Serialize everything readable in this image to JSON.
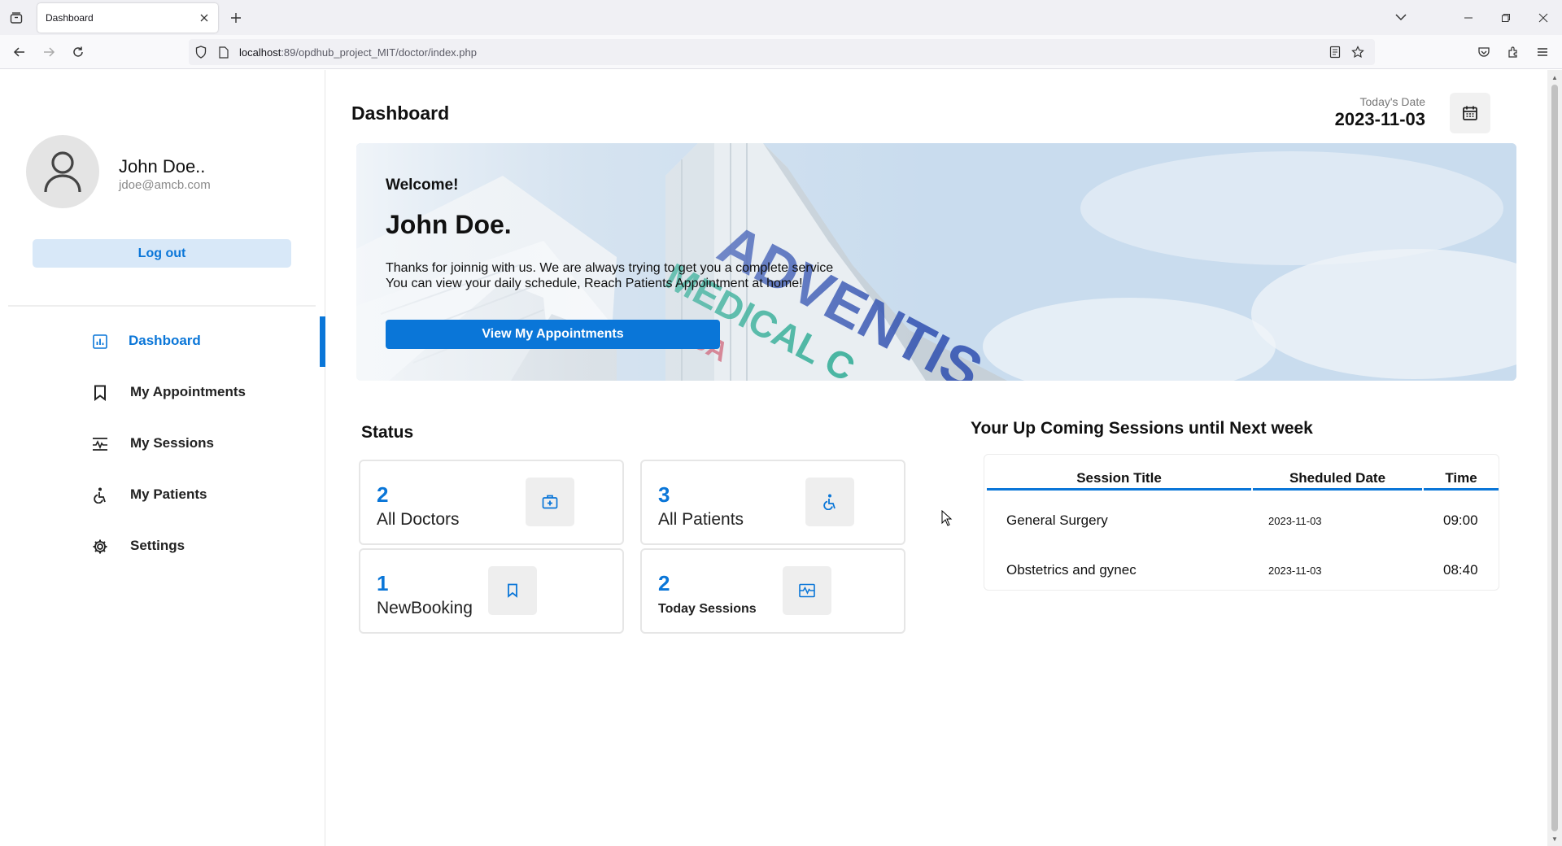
{
  "browser": {
    "tab_title": "Dashboard",
    "url_host": "localhost",
    "url_rest": ":89/opdhub_project_MIT/doctor/index.php"
  },
  "sidebar": {
    "profile_name": "John Doe..",
    "profile_email": "jdoe@amcb.com",
    "logout_label": "Log out",
    "items": [
      {
        "label": "Dashboard",
        "icon": "dashboard-icon",
        "active": true
      },
      {
        "label": "My Appointments",
        "icon": "bookmark-icon",
        "active": false
      },
      {
        "label": "My Sessions",
        "icon": "sessions-icon",
        "active": false
      },
      {
        "label": "My Patients",
        "icon": "wheelchair-icon",
        "active": false
      },
      {
        "label": "Settings",
        "icon": "gear-icon",
        "active": false
      }
    ]
  },
  "header": {
    "title": "Dashboard",
    "today_label": "Today's Date",
    "today_value": "2023-11-03"
  },
  "banner": {
    "welcome": "Welcome!",
    "name": "John Doe.",
    "line1": "Thanks for joinnig with us. We are always trying to get you a complete service",
    "line2": "You can view your daily schedule, Reach Patients Appointment at home!",
    "button_label": "View My Appointments"
  },
  "status": {
    "title": "Status",
    "cards": [
      {
        "number": "2",
        "label": "All Doctors",
        "icon": "medical-bag-icon"
      },
      {
        "number": "3",
        "label": "All Patients",
        "icon": "wheelchair-icon"
      },
      {
        "number": "1",
        "label": "NewBooking",
        "icon": "bookmark-icon"
      },
      {
        "number": "2",
        "label": "Today Sessions",
        "icon": "sessions-icon"
      }
    ]
  },
  "sessions": {
    "title": "Your Up Coming Sessions until Next week",
    "headers": [
      "Session Title",
      "Sheduled Date",
      "Time"
    ],
    "rows": [
      {
        "title": "General Surgery",
        "date": "2023-11-03",
        "time": "09:00"
      },
      {
        "title": "Obstetrics and gynec",
        "date": "2023-11-03",
        "time": "08:40"
      }
    ]
  }
}
